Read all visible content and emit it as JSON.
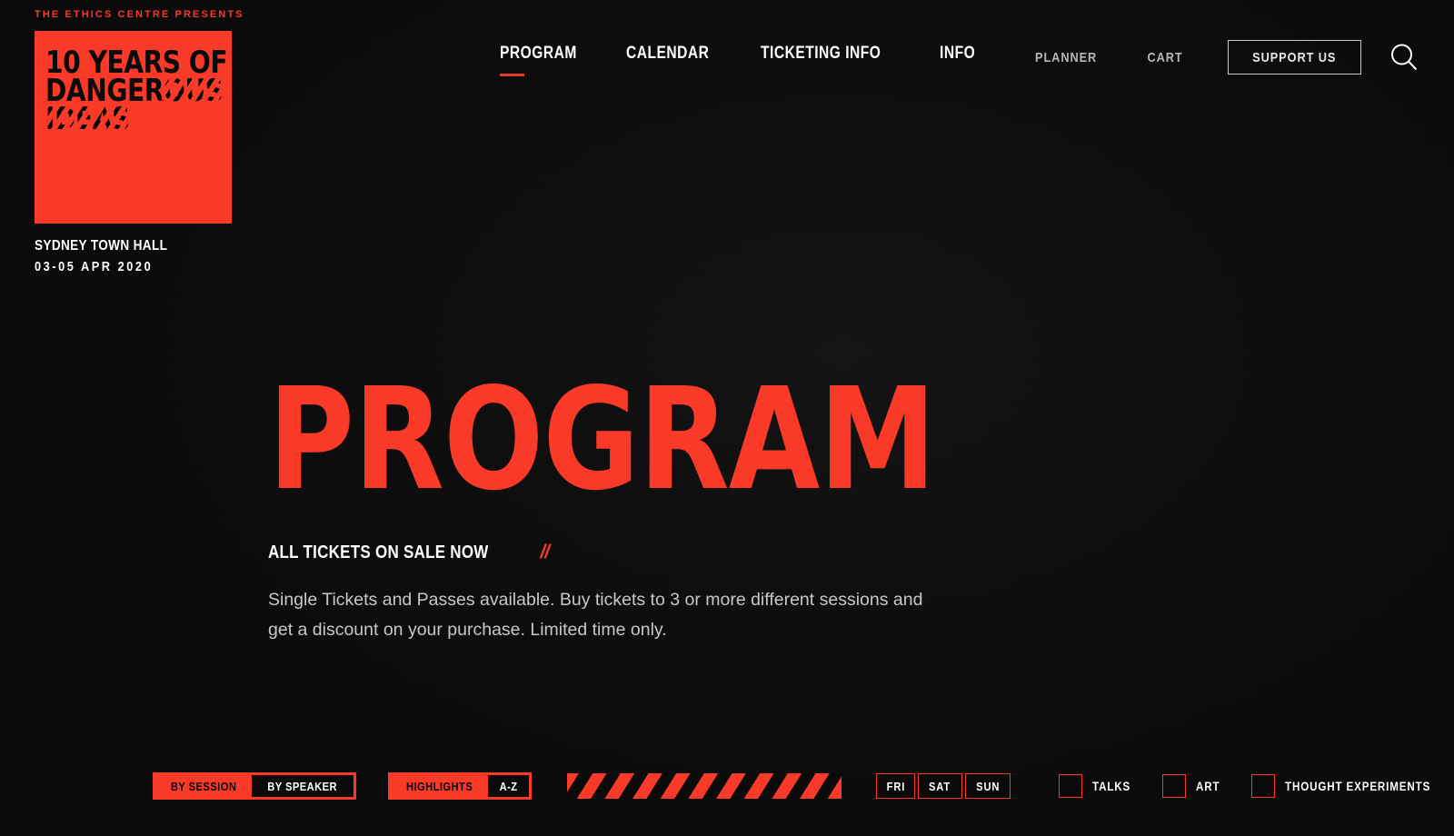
{
  "brand": {
    "presents": "THE ETHICS CENTRE PRESENTS",
    "logo_line1": "10 YEARS OF",
    "logo_line2_visible": "DANGER",
    "logo_line2_masked": "OUS",
    "logo_line3_masked": "IDEAS",
    "venue": "SYDNEY TOWN HALL",
    "dates": "03-05 APR 2020",
    "accent_color": "#F93A28",
    "background_color": "#0a0a0a"
  },
  "nav": {
    "items": [
      {
        "label": "PROGRAM",
        "active": true
      },
      {
        "label": "CALENDAR",
        "active": false
      },
      {
        "label": "TICKETING INFO",
        "active": false
      },
      {
        "label": "INFO",
        "active": false
      }
    ]
  },
  "header_right": {
    "planner": "PLANNER",
    "cart": "CART",
    "support": "SUPPORT US",
    "search_icon": "search-icon"
  },
  "hero": {
    "title": "PROGRAM",
    "subtitle": "ALL TICKETS ON SALE NOW",
    "slashes": "//",
    "body": "Single Tickets and Passes available. Buy tickets to 3 or more different sessions and get a discount on your purchase. Limited time only."
  },
  "filters": {
    "view_toggle": {
      "option_a": "BY SESSION",
      "option_b": "BY SPEAKER",
      "selected": "BY SPEAKER"
    },
    "sort_toggle": {
      "option_a": "HIGHLIGHTS",
      "option_b": "A-Z",
      "selected": "A-Z"
    },
    "days": [
      {
        "label": "FRI"
      },
      {
        "label": "SAT"
      },
      {
        "label": "SUN"
      }
    ],
    "categories": [
      {
        "label": "TALKS",
        "checked": false
      },
      {
        "label": "ART",
        "checked": false
      },
      {
        "label": "THOUGHT EXPERIMENTS",
        "checked": false
      }
    ]
  }
}
